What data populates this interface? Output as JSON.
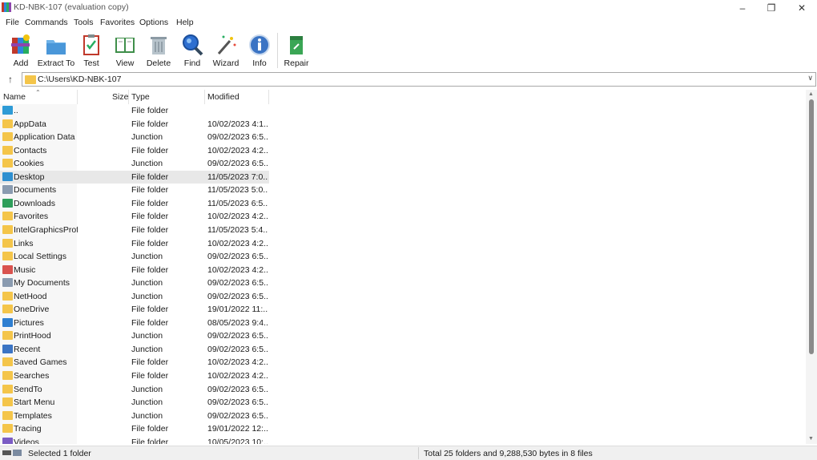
{
  "window": {
    "title": "KD-NBK-107 (evaluation copy)",
    "controls": [
      "minimize-icon",
      "restore-icon",
      "close-icon"
    ]
  },
  "menu": [
    "File",
    "Commands",
    "Tools",
    "Favorites",
    "Options",
    "Help"
  ],
  "toolbar": [
    {
      "label": "Add",
      "icon": "add-archive-icon"
    },
    {
      "label": "Extract To",
      "icon": "extract-folder-icon"
    },
    {
      "label": "Test",
      "icon": "test-clipboard-icon"
    },
    {
      "label": "View",
      "icon": "view-book-icon"
    },
    {
      "label": "Delete",
      "icon": "trash-icon"
    },
    {
      "label": "Find",
      "icon": "magnifier-icon"
    },
    {
      "label": "Wizard",
      "icon": "wand-icon"
    },
    {
      "label": "Info",
      "icon": "info-icon"
    },
    {
      "label": "Repair",
      "icon": "repair-kit-icon"
    }
  ],
  "address": {
    "path": "C:\\Users\\KD-NBK-107"
  },
  "columns": {
    "name": "Name",
    "size": "Size",
    "type": "Type",
    "modified": "Modified"
  },
  "files": [
    {
      "name": "..",
      "type": "File folder",
      "modified": "",
      "icon": "parent-folder-icon",
      "color": "#2e9bd6"
    },
    {
      "name": "AppData",
      "type": "File folder",
      "modified": "10/02/2023 4:1...",
      "icon": "folder-icon",
      "color": "#f4c54a"
    },
    {
      "name": "Application Data",
      "type": "Junction",
      "modified": "09/02/2023 6:5...",
      "icon": "folder-icon",
      "color": "#f4c54a"
    },
    {
      "name": "Contacts",
      "type": "File folder",
      "modified": "10/02/2023 4:2...",
      "icon": "folder-icon",
      "color": "#f4c54a"
    },
    {
      "name": "Cookies",
      "type": "Junction",
      "modified": "09/02/2023 6:5...",
      "icon": "folder-icon",
      "color": "#f4c54a"
    },
    {
      "name": "Desktop",
      "type": "File folder",
      "modified": "11/05/2023 7:0...",
      "icon": "desktop-folder-icon",
      "color": "#2e8fd0",
      "selected": true
    },
    {
      "name": "Documents",
      "type": "File folder",
      "modified": "11/05/2023 5:0...",
      "icon": "documents-folder-icon",
      "color": "#8a9bb0"
    },
    {
      "name": "Downloads",
      "type": "File folder",
      "modified": "11/05/2023 6:5...",
      "icon": "download-arrow-icon",
      "color": "#2f9e5a"
    },
    {
      "name": "Favorites",
      "type": "File folder",
      "modified": "10/02/2023 4:2...",
      "icon": "folder-icon",
      "color": "#f4c54a"
    },
    {
      "name": "IntelGraphicsProf...",
      "type": "File folder",
      "modified": "11/05/2023 5:4...",
      "icon": "folder-icon",
      "color": "#f4c54a"
    },
    {
      "name": "Links",
      "type": "File folder",
      "modified": "10/02/2023 4:2...",
      "icon": "folder-icon",
      "color": "#f4c54a"
    },
    {
      "name": "Local Settings",
      "type": "Junction",
      "modified": "09/02/2023 6:5...",
      "icon": "folder-icon",
      "color": "#f4c54a"
    },
    {
      "name": "Music",
      "type": "File folder",
      "modified": "10/02/2023 4:2...",
      "icon": "music-icon",
      "color": "#d9534f"
    },
    {
      "name": "My Documents",
      "type": "Junction",
      "modified": "09/02/2023 6:5...",
      "icon": "documents-folder-icon",
      "color": "#8a9bb0"
    },
    {
      "name": "NetHood",
      "type": "Junction",
      "modified": "09/02/2023 6:5...",
      "icon": "folder-icon",
      "color": "#f4c54a"
    },
    {
      "name": "OneDrive",
      "type": "File folder",
      "modified": "19/01/2022 11:...",
      "icon": "folder-icon",
      "color": "#f4c54a"
    },
    {
      "name": "Pictures",
      "type": "File folder",
      "modified": "08/05/2023 9:4...",
      "icon": "pictures-icon",
      "color": "#2f7fd1"
    },
    {
      "name": "PrintHood",
      "type": "Junction",
      "modified": "09/02/2023 6:5...",
      "icon": "folder-icon",
      "color": "#f4c54a"
    },
    {
      "name": "Recent",
      "type": "Junction",
      "modified": "09/02/2023 6:5...",
      "icon": "recent-icon",
      "color": "#3b74c4"
    },
    {
      "name": "Saved Games",
      "type": "File folder",
      "modified": "10/02/2023 4:2...",
      "icon": "folder-icon",
      "color": "#f4c54a"
    },
    {
      "name": "Searches",
      "type": "File folder",
      "modified": "10/02/2023 4:2...",
      "icon": "folder-icon",
      "color": "#f4c54a"
    },
    {
      "name": "SendTo",
      "type": "Junction",
      "modified": "09/02/2023 6:5...",
      "icon": "folder-icon",
      "color": "#f4c54a"
    },
    {
      "name": "Start Menu",
      "type": "Junction",
      "modified": "09/02/2023 6:5...",
      "icon": "folder-icon",
      "color": "#f4c54a"
    },
    {
      "name": "Templates",
      "type": "Junction",
      "modified": "09/02/2023 6:5...",
      "icon": "folder-icon",
      "color": "#f4c54a"
    },
    {
      "name": "Tracing",
      "type": "File folder",
      "modified": "19/01/2022 12:...",
      "icon": "folder-icon",
      "color": "#f4c54a"
    },
    {
      "name": "Videos",
      "type": "File folder",
      "modified": "10/05/2023 10:...",
      "icon": "videos-icon",
      "color": "#7b5cc4"
    }
  ],
  "status": {
    "left": "Selected 1 folder",
    "right": "Total 25 folders and 9,288,530 bytes in 8 files"
  }
}
